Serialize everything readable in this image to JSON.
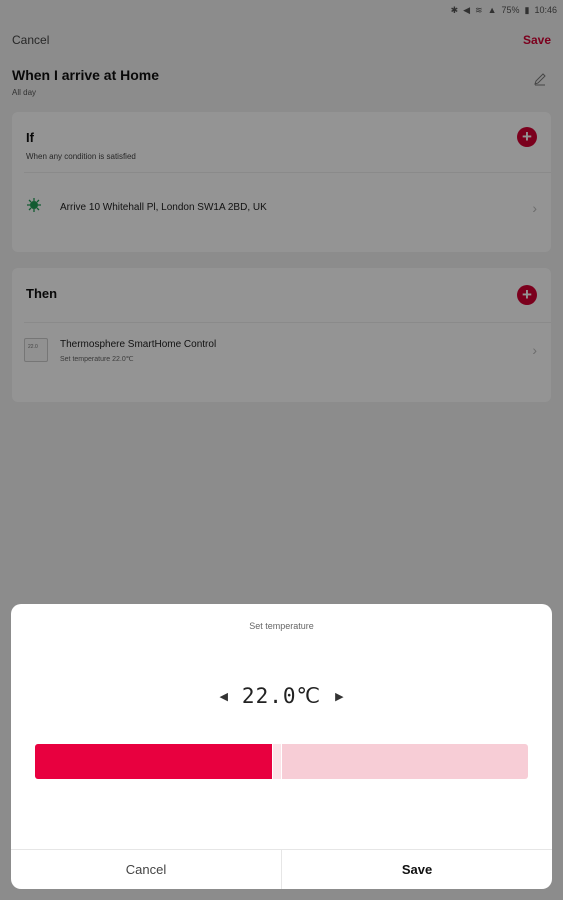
{
  "status_bar": {
    "battery": "75%",
    "time": "10:46",
    "icons": [
      "bluetooth-icon",
      "mute-icon",
      "wifi-icon",
      "signal-icon",
      "battery-icon"
    ]
  },
  "topbar": {
    "cancel_label": "Cancel",
    "save_label": "Save",
    "accent_color": "#d40033"
  },
  "scene": {
    "title": "When I arrive at Home",
    "subtitle": "All day"
  },
  "if_card": {
    "heading": "If",
    "description": "When any condition is satisfied",
    "condition": {
      "icon": "location-pin-icon",
      "label": "Arrive 10 Whitehall Pl, London SW1A 2BD, UK"
    }
  },
  "then_card": {
    "heading": "Then",
    "action": {
      "icon": "thermostat-icon",
      "icon_text": "22.0",
      "label": "Thermosphere SmartHome Control",
      "detail": "Set temperature 22.0℃"
    }
  },
  "sheet": {
    "title": "Set temperature",
    "value": "22.0℃",
    "slider_fraction": 0.48,
    "slider_fill_color": "#e8003f",
    "slider_track_color": "#f7cdd6",
    "cancel_label": "Cancel",
    "save_label": "Save"
  }
}
